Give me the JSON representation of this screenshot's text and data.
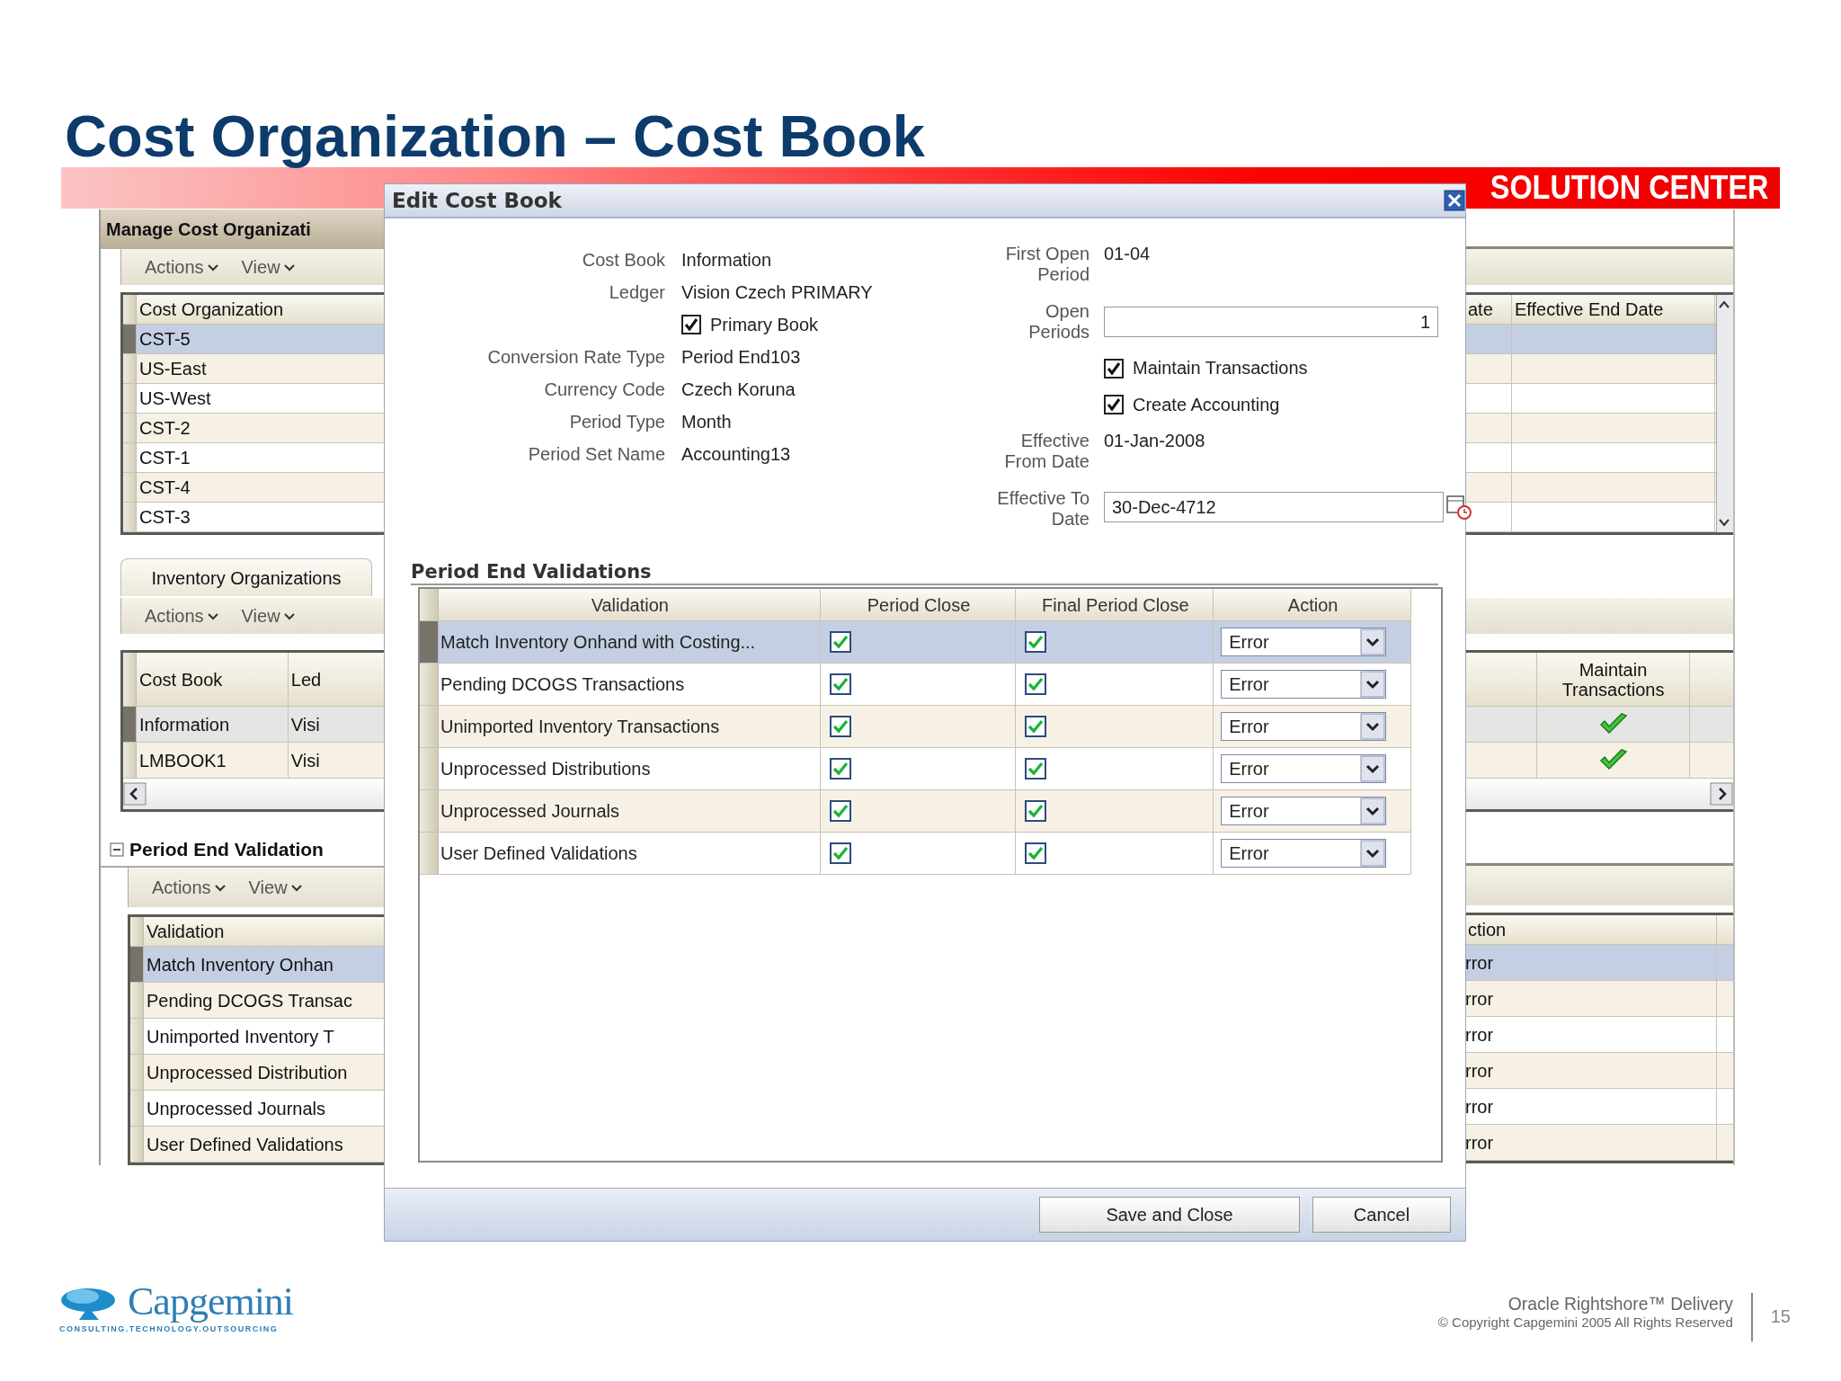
{
  "slide": {
    "title": "Cost Organization – Cost Book",
    "banner": "SOLUTION CENTER"
  },
  "background_app": {
    "panel_title": "Manage Cost Organizati",
    "toolbars": [
      {
        "actions": "Actions",
        "view": "View"
      },
      {
        "actions": "Actions",
        "view": "View"
      },
      {
        "actions": "Actions",
        "view": "View"
      }
    ],
    "cost_organizations": {
      "columns": [
        "Cost Organization",
        "ate",
        "Effective End Date"
      ],
      "rows": [
        {
          "name": "CST-5",
          "selected": true
        },
        {
          "name": "US-East",
          "selected": false
        },
        {
          "name": "US-West",
          "selected": false
        },
        {
          "name": "CST-2",
          "selected": false
        },
        {
          "name": "CST-1",
          "selected": false
        },
        {
          "name": "CST-4",
          "selected": false
        },
        {
          "name": "CST-3",
          "selected": false
        }
      ]
    },
    "tab": {
      "label": "Inventory Organizations",
      "selected": true
    },
    "cost_books": {
      "columns": [
        "Cost Book",
        "Led",
        "Maintain Transactions"
      ],
      "rows": [
        {
          "cost_book": "Information",
          "ledger": "Visi",
          "maintain_transactions": true,
          "selected": true
        },
        {
          "cost_book": "LMBOOK1",
          "ledger": "Visi",
          "maintain_transactions": true,
          "selected": false
        }
      ]
    },
    "validation_section": {
      "title": "Period End Validation",
      "expanded": true
    },
    "validations": {
      "columns": [
        "Validation",
        "ction"
      ],
      "rows": [
        {
          "name": "Match Inventory Onhan",
          "action": "rror",
          "selected": true
        },
        {
          "name": "Pending DCOGS Transac",
          "action": "rror",
          "selected": false
        },
        {
          "name": "Unimported Inventory T",
          "action": "rror",
          "selected": false
        },
        {
          "name": "Unprocessed Distribution",
          "action": "rror",
          "selected": false
        },
        {
          "name": "Unprocessed Journals",
          "action": "rror",
          "selected": false
        },
        {
          "name": "User Defined Validations",
          "action": "rror",
          "selected": false
        }
      ]
    }
  },
  "dialog": {
    "title": "Edit Cost Book",
    "fields_left": [
      {
        "kind": "text",
        "label": "Cost Book",
        "value": "Information"
      },
      {
        "kind": "text",
        "label": "Ledger",
        "value": "Vision Czech PRIMARY"
      },
      {
        "kind": "checkbox",
        "label": "Primary Book",
        "checked": true
      },
      {
        "kind": "text",
        "label": "Conversion Rate Type",
        "value": "Period End103"
      },
      {
        "kind": "text",
        "label": "Currency Code",
        "value": "Czech Koruna"
      },
      {
        "kind": "text",
        "label": "Period Type",
        "value": "Month"
      },
      {
        "kind": "text",
        "label": "Period Set Name",
        "value": "Accounting13"
      }
    ],
    "fields_right": [
      {
        "kind": "text",
        "label": "First Open Period",
        "value": "01-04"
      },
      {
        "kind": "input",
        "label": "Open Periods",
        "value": "1"
      },
      {
        "kind": "checkbox",
        "label": "Maintain Transactions",
        "checked": true
      },
      {
        "kind": "checkbox",
        "label": "Create Accounting",
        "checked": true
      },
      {
        "kind": "text",
        "label": "Effective From Date",
        "value": "01-Jan-2008"
      },
      {
        "kind": "date",
        "label": "Effective To Date",
        "value": "30-Dec-4712"
      }
    ],
    "validations": {
      "title": "Period End Validations",
      "columns": [
        "Validation",
        "Period Close",
        "Final Period Close",
        "Action"
      ],
      "rows": [
        {
          "name": "Match Inventory Onhand with Costing...",
          "period_close": true,
          "final_period_close": true,
          "action": "Error",
          "selected": true
        },
        {
          "name": "Pending DCOGS Transactions",
          "period_close": true,
          "final_period_close": true,
          "action": "Error",
          "selected": false
        },
        {
          "name": "Unimported Inventory Transactions",
          "period_close": true,
          "final_period_close": true,
          "action": "Error",
          "selected": false
        },
        {
          "name": "Unprocessed Distributions",
          "period_close": true,
          "final_period_close": true,
          "action": "Error",
          "selected": false
        },
        {
          "name": "Unprocessed Journals",
          "period_close": true,
          "final_period_close": true,
          "action": "Error",
          "selected": false
        },
        {
          "name": "User Defined Validations",
          "period_close": true,
          "final_period_close": true,
          "action": "Error",
          "selected": false
        }
      ]
    },
    "buttons": [
      "Save and Close",
      "Cancel"
    ]
  },
  "footer": {
    "logo": "Capgemini",
    "tagline": "CONSULTING.TECHNOLOGY.OUTSOURCING",
    "delivery": "Oracle Rightshore™ Delivery",
    "copyright": "© Copyright Capgemini 2005 All Rights Reserved",
    "page": "15"
  }
}
